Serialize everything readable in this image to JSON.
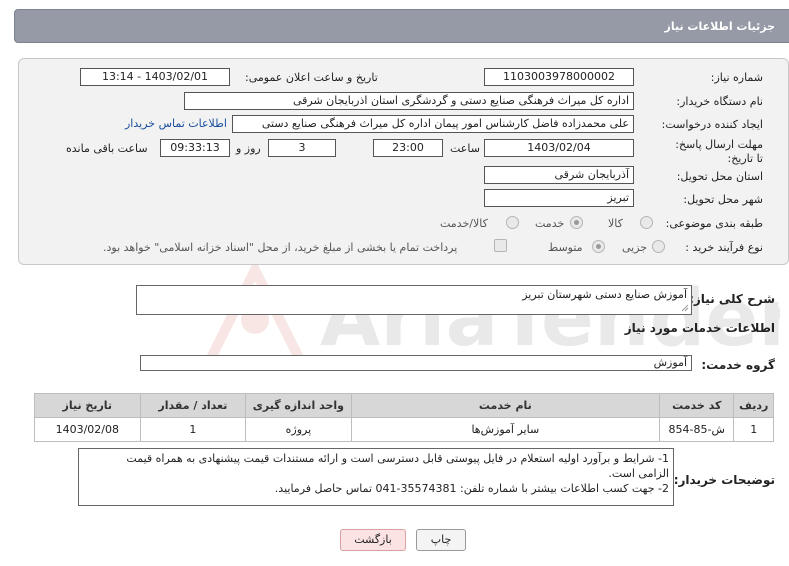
{
  "header": {
    "title": "جزئیات اطلاعات نیاز"
  },
  "form": {
    "need_number": {
      "label": "شماره نیاز:",
      "value": "1103003978000002"
    },
    "announce_datetime": {
      "label": "تاریخ و ساعت اعلان عمومی:",
      "value": "1403/02/01 - 13:14"
    },
    "buyer_org": {
      "label": "نام دستگاه خریدار:",
      "value": "اداره کل میراث فرهنگی  صنایع دستی و گردشگری استان اذربایجان شرقی"
    },
    "requester": {
      "label": "ایجاد کننده درخواست:",
      "value": "علی محمدزاده فاضل کارشناس امور پیمان اداره کل میراث فرهنگی  صنایع دستی",
      "contact_link": "اطلاعات تماس خریدار"
    },
    "deadline": {
      "label": "مهلت ارسال پاسخ: تا تاریخ:",
      "date": "1403/02/04",
      "time_label": "ساعت",
      "time": "23:00",
      "days": "3",
      "days_label": "روز و",
      "remaining": "09:33:13",
      "remaining_label": "ساعت باقی مانده"
    },
    "delivery_province": {
      "label": "استان محل تحویل:",
      "value": "آذربایجان شرقی"
    },
    "delivery_city": {
      "label": "شهر محل تحویل:",
      "value": "تبریز"
    },
    "category": {
      "label": "طبقه بندی موضوعی:",
      "options": [
        "کالا",
        "خدمت",
        "کالا/خدمت"
      ],
      "selected": "خدمت"
    },
    "purchase_process": {
      "label": "نوع فرآیند خرید :",
      "options": [
        "جزیی",
        "متوسط"
      ],
      "selected": "متوسط",
      "payment_note": "پرداخت تمام یا بخشی از مبلغ خرید، از محل \"اسناد خزانه اسلامی\" خواهد بود."
    }
  },
  "summary": {
    "label": "شرح کلی نیاز:",
    "value": "آموزش صنایع دستی شهرستان تبریز"
  },
  "services_title": "اطلاعات خدمات مورد نیاز",
  "service_group": {
    "label": "گروه خدمت:",
    "value": "آموزش"
  },
  "table": {
    "headers": [
      "ردیف",
      "کد خدمت",
      "نام خدمت",
      "واحد اندازه گیری",
      "تعداد / مقدار",
      "تاریخ نیاز"
    ],
    "rows": [
      [
        "1",
        "ش-85-854",
        "سایر آموزش‌ها",
        "پروژه",
        "1",
        "1403/02/08"
      ]
    ]
  },
  "buyer_notes": {
    "label": "توضیحات خریدار:",
    "lines": [
      "1- شرایط و برآورد اولیه استعلام در فایل پیوستی قابل دسترسی است و ارائه مستندات قیمت پیشنهادی به همراه قیمت",
      "الزامی است.",
      "2- جهت کسب اطلاعات بیشتر  با شماره تلفن: 35574381-041  تماس حاصل فرمایید."
    ]
  },
  "buttons": {
    "print": "چاپ",
    "back": "بازگشت"
  },
  "watermark_text": "AriaTender.neT",
  "colors": {
    "header_bg": "#959aa6",
    "link": "#1a4ea0",
    "back_button_bg": "#fbe3e3",
    "watermark": "#c0392b"
  }
}
